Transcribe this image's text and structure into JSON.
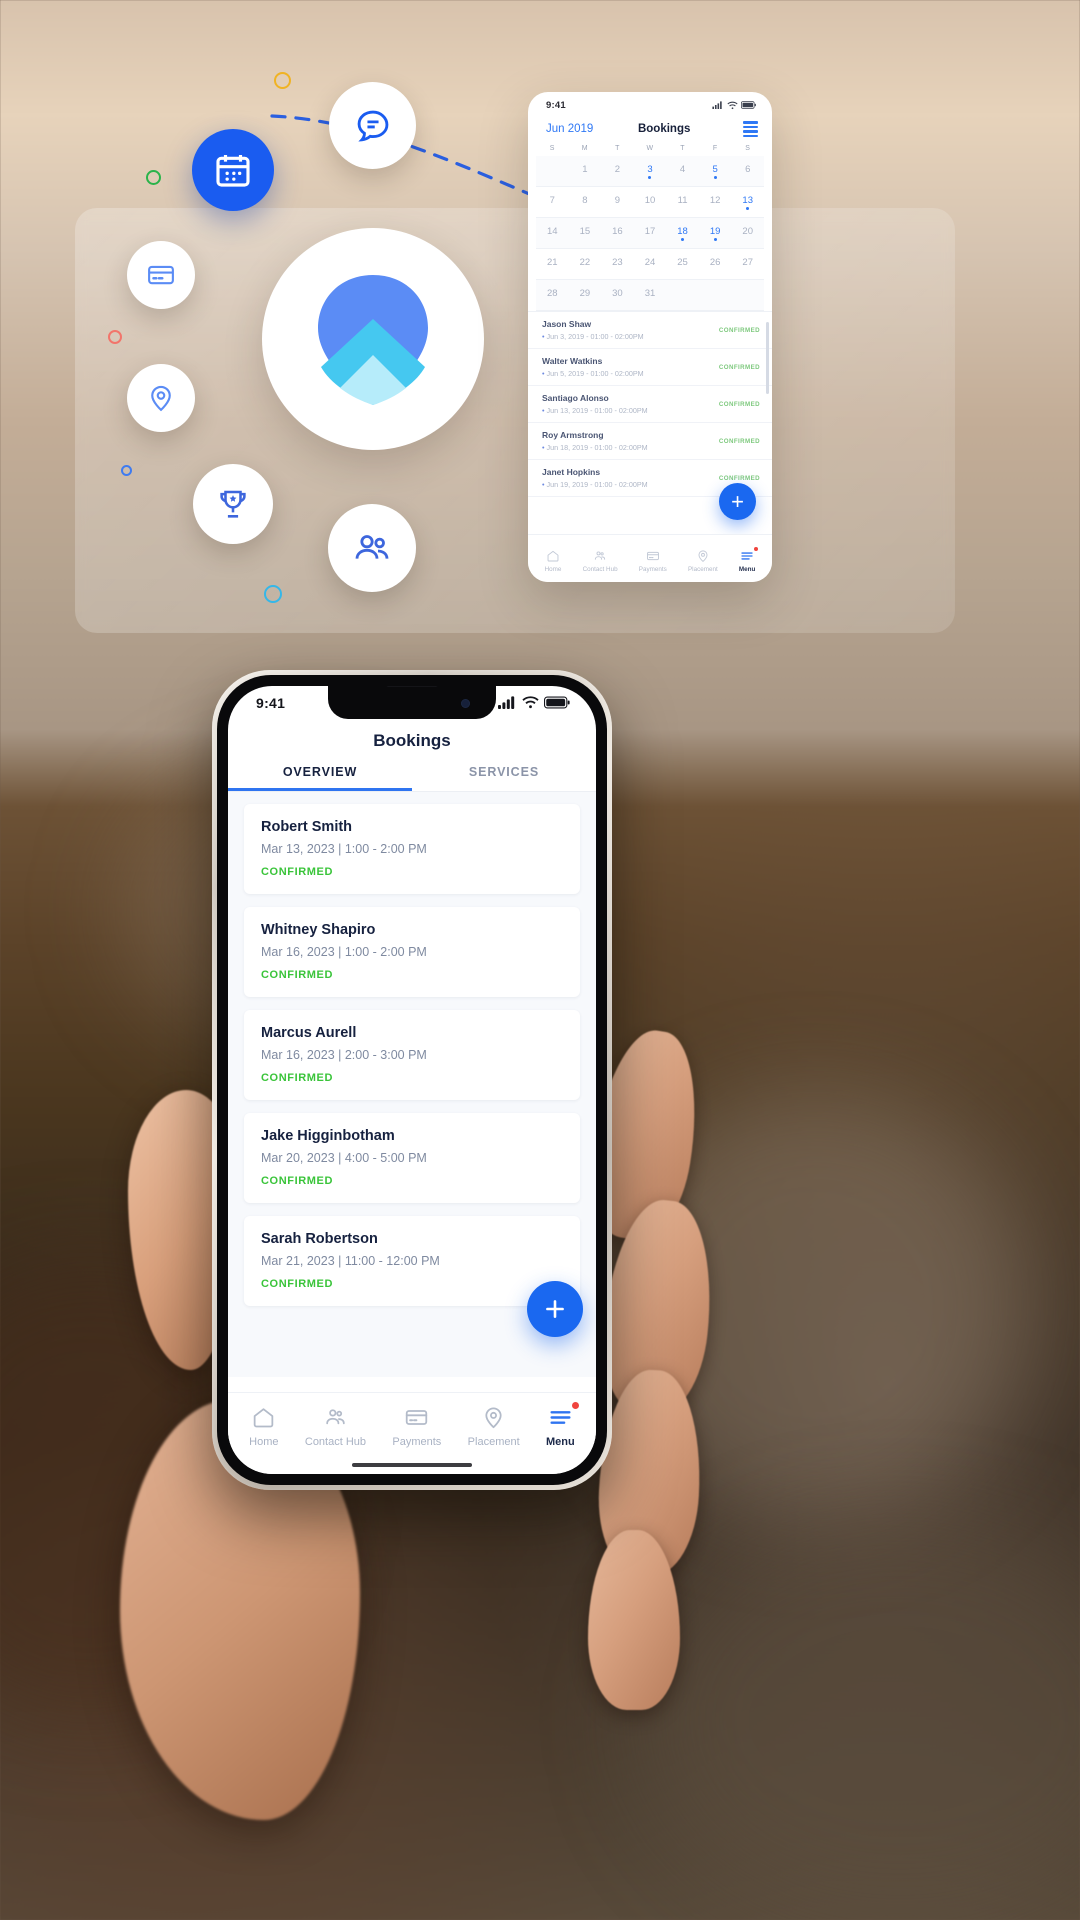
{
  "mini_phone": {
    "status": {
      "time": "9:41",
      "signal_icon": "cellular-signal-icon",
      "wifi_icon": "wifi-icon",
      "battery_icon": "battery-icon"
    },
    "header": {
      "month_label": "Jun 2019",
      "title": "Bookings",
      "list_view_icon": "list-view-icon"
    },
    "calendar": {
      "day_initials": [
        "S",
        "M",
        "T",
        "W",
        "T",
        "F",
        "S"
      ],
      "weeks": [
        [
          {
            "d": ""
          },
          {
            "d": "1"
          },
          {
            "d": "2"
          },
          {
            "d": "3",
            "hl": true,
            "dot": true
          },
          {
            "d": "4"
          },
          {
            "d": "5",
            "hl": true,
            "dot": true
          },
          {
            "d": "6"
          }
        ],
        [
          {
            "d": "7"
          },
          {
            "d": "8"
          },
          {
            "d": "9"
          },
          {
            "d": "10"
          },
          {
            "d": "11"
          },
          {
            "d": "12"
          },
          {
            "d": "13",
            "hl": true,
            "dot": true
          }
        ],
        [
          {
            "d": "14"
          },
          {
            "d": "15"
          },
          {
            "d": "16"
          },
          {
            "d": "17"
          },
          {
            "d": "18",
            "hl": true,
            "dot": true
          },
          {
            "d": "19",
            "hl": true,
            "dot": true
          },
          {
            "d": "20"
          }
        ],
        [
          {
            "d": "21"
          },
          {
            "d": "22"
          },
          {
            "d": "23"
          },
          {
            "d": "24"
          },
          {
            "d": "25"
          },
          {
            "d": "26"
          },
          {
            "d": "27"
          }
        ],
        [
          {
            "d": "28"
          },
          {
            "d": "29"
          },
          {
            "d": "30"
          },
          {
            "d": "31"
          },
          {
            "d": ""
          },
          {
            "d": ""
          },
          {
            "d": ""
          }
        ]
      ]
    },
    "bookings": [
      {
        "name": "Jason Shaw",
        "meta": "Jun 3, 2019 - 01:00 - 02:00PM",
        "status": "CONFIRMED"
      },
      {
        "name": "Walter Watkins",
        "meta": "Jun 5, 2019 - 01:00 - 02:00PM",
        "status": "CONFIRMED"
      },
      {
        "name": "Santiago Alonso",
        "meta": "Jun 13, 2019 - 01:00 - 02:00PM",
        "status": "CONFIRMED"
      },
      {
        "name": "Roy Armstrong",
        "meta": "Jun 18, 2019 - 01:00 - 02:00PM",
        "status": "CONFIRMED"
      },
      {
        "name": "Janet Hopkins",
        "meta": "Jun 19, 2019 - 01:00 - 02:00PM",
        "status": "CONFIRMED"
      }
    ],
    "fab_label": "+",
    "nav": [
      {
        "label": "Home",
        "icon": "home-icon"
      },
      {
        "label": "Contact Hub",
        "icon": "contacts-icon"
      },
      {
        "label": "Payments",
        "icon": "credit-card-icon"
      },
      {
        "label": "Placement",
        "icon": "location-pin-icon"
      },
      {
        "label": "Menu",
        "icon": "hamburger-menu-icon"
      }
    ]
  },
  "main_phone": {
    "status": {
      "time": "9:41",
      "signal_icon": "cellular-signal-icon",
      "wifi_icon": "wifi-icon",
      "battery_icon": "battery-icon"
    },
    "title": "Bookings",
    "tabs": [
      {
        "label": "OVERVIEW",
        "active": true
      },
      {
        "label": "SERVICES",
        "active": false
      }
    ],
    "bookings": [
      {
        "name": "Robert Smith",
        "meta": "Mar 13, 2023 | 1:00 - 2:00 PM",
        "status": "CONFIRMED"
      },
      {
        "name": "Whitney Shapiro",
        "meta": "Mar 16, 2023 | 1:00 - 2:00 PM",
        "status": "CONFIRMED"
      },
      {
        "name": "Marcus Aurell",
        "meta": "Mar 16, 2023 | 2:00 - 3:00 PM",
        "status": "CONFIRMED"
      },
      {
        "name": "Jake Higginbotham",
        "meta": "Mar 20, 2023 | 4:00 - 5:00 PM",
        "status": "CONFIRMED"
      },
      {
        "name": "Sarah Robertson",
        "meta": "Mar 21, 2023 | 11:00 - 12:00 PM",
        "status": "CONFIRMED"
      }
    ],
    "fab": {
      "icon": "plus-icon",
      "label": "+"
    },
    "nav": [
      {
        "label": "Home",
        "icon": "home-icon",
        "active": false
      },
      {
        "label": "Contact Hub",
        "icon": "contacts-icon",
        "active": false
      },
      {
        "label": "Payments",
        "icon": "credit-card-icon",
        "active": false
      },
      {
        "label": "Placement",
        "icon": "location-pin-icon",
        "active": false
      },
      {
        "label": "Menu",
        "icon": "hamburger-menu-icon",
        "active": true,
        "badge": true
      }
    ]
  },
  "hero": {
    "logo_icon": "app-logo-chevron-pin-icon",
    "orbs": [
      {
        "icon": "calendar-icon"
      },
      {
        "icon": "chat-bubble-icon"
      },
      {
        "icon": "credit-card-icon"
      },
      {
        "icon": "location-pin-icon"
      },
      {
        "icon": "trophy-icon"
      },
      {
        "icon": "people-icon"
      }
    ]
  },
  "colors": {
    "accent_blue": "#1a5cf0",
    "link_blue": "#2f78f5",
    "status_green": "#3ac43a",
    "badge_red": "#f0443e",
    "text_dark": "#16213f",
    "text_muted": "#7f8aa0"
  }
}
